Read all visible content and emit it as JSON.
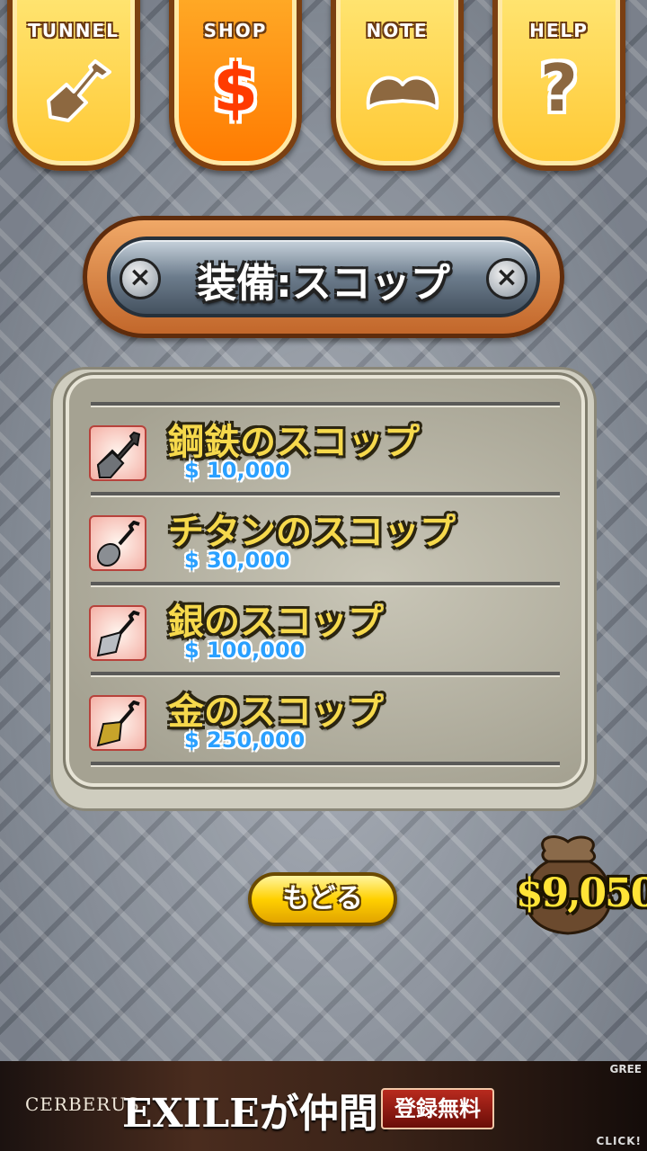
{
  "tabs": [
    {
      "label": "TUNNEL",
      "icon": "shovel-icon"
    },
    {
      "label": "SHOP",
      "icon": "dollar-icon",
      "glyph": "$"
    },
    {
      "label": "NOTE",
      "icon": "mustache-icon"
    },
    {
      "label": "HELP",
      "icon": "question-icon",
      "glyph": "?"
    }
  ],
  "active_tab": "SHOP",
  "title": "装備:スコップ",
  "items": [
    {
      "name": "鋼鉄のスコップ",
      "price": "$ 10,000",
      "icon": "steel-shovel-icon"
    },
    {
      "name": "チタンのスコップ",
      "price": "$ 30,000",
      "icon": "titanium-shovel-icon"
    },
    {
      "name": "銀のスコップ",
      "price": "$ 100,000",
      "icon": "silver-shovel-icon"
    },
    {
      "name": "金のスコップ",
      "price": "$ 250,000",
      "icon": "gold-shovel-icon"
    }
  ],
  "back_button": "もどる",
  "money": "$9,050",
  "ad": {
    "brand": "CERBERUS",
    "headline": "EXILEが仲間に!",
    "cta": "登録無料",
    "corner": "GREE",
    "click": "CLICK!"
  },
  "colors": {
    "tab_fill": "#ffc833",
    "active_tab_fill": "#ff7a00",
    "item_name": "#f6d94c",
    "item_price": "#2aa0ff",
    "money": "#ffe437"
  }
}
